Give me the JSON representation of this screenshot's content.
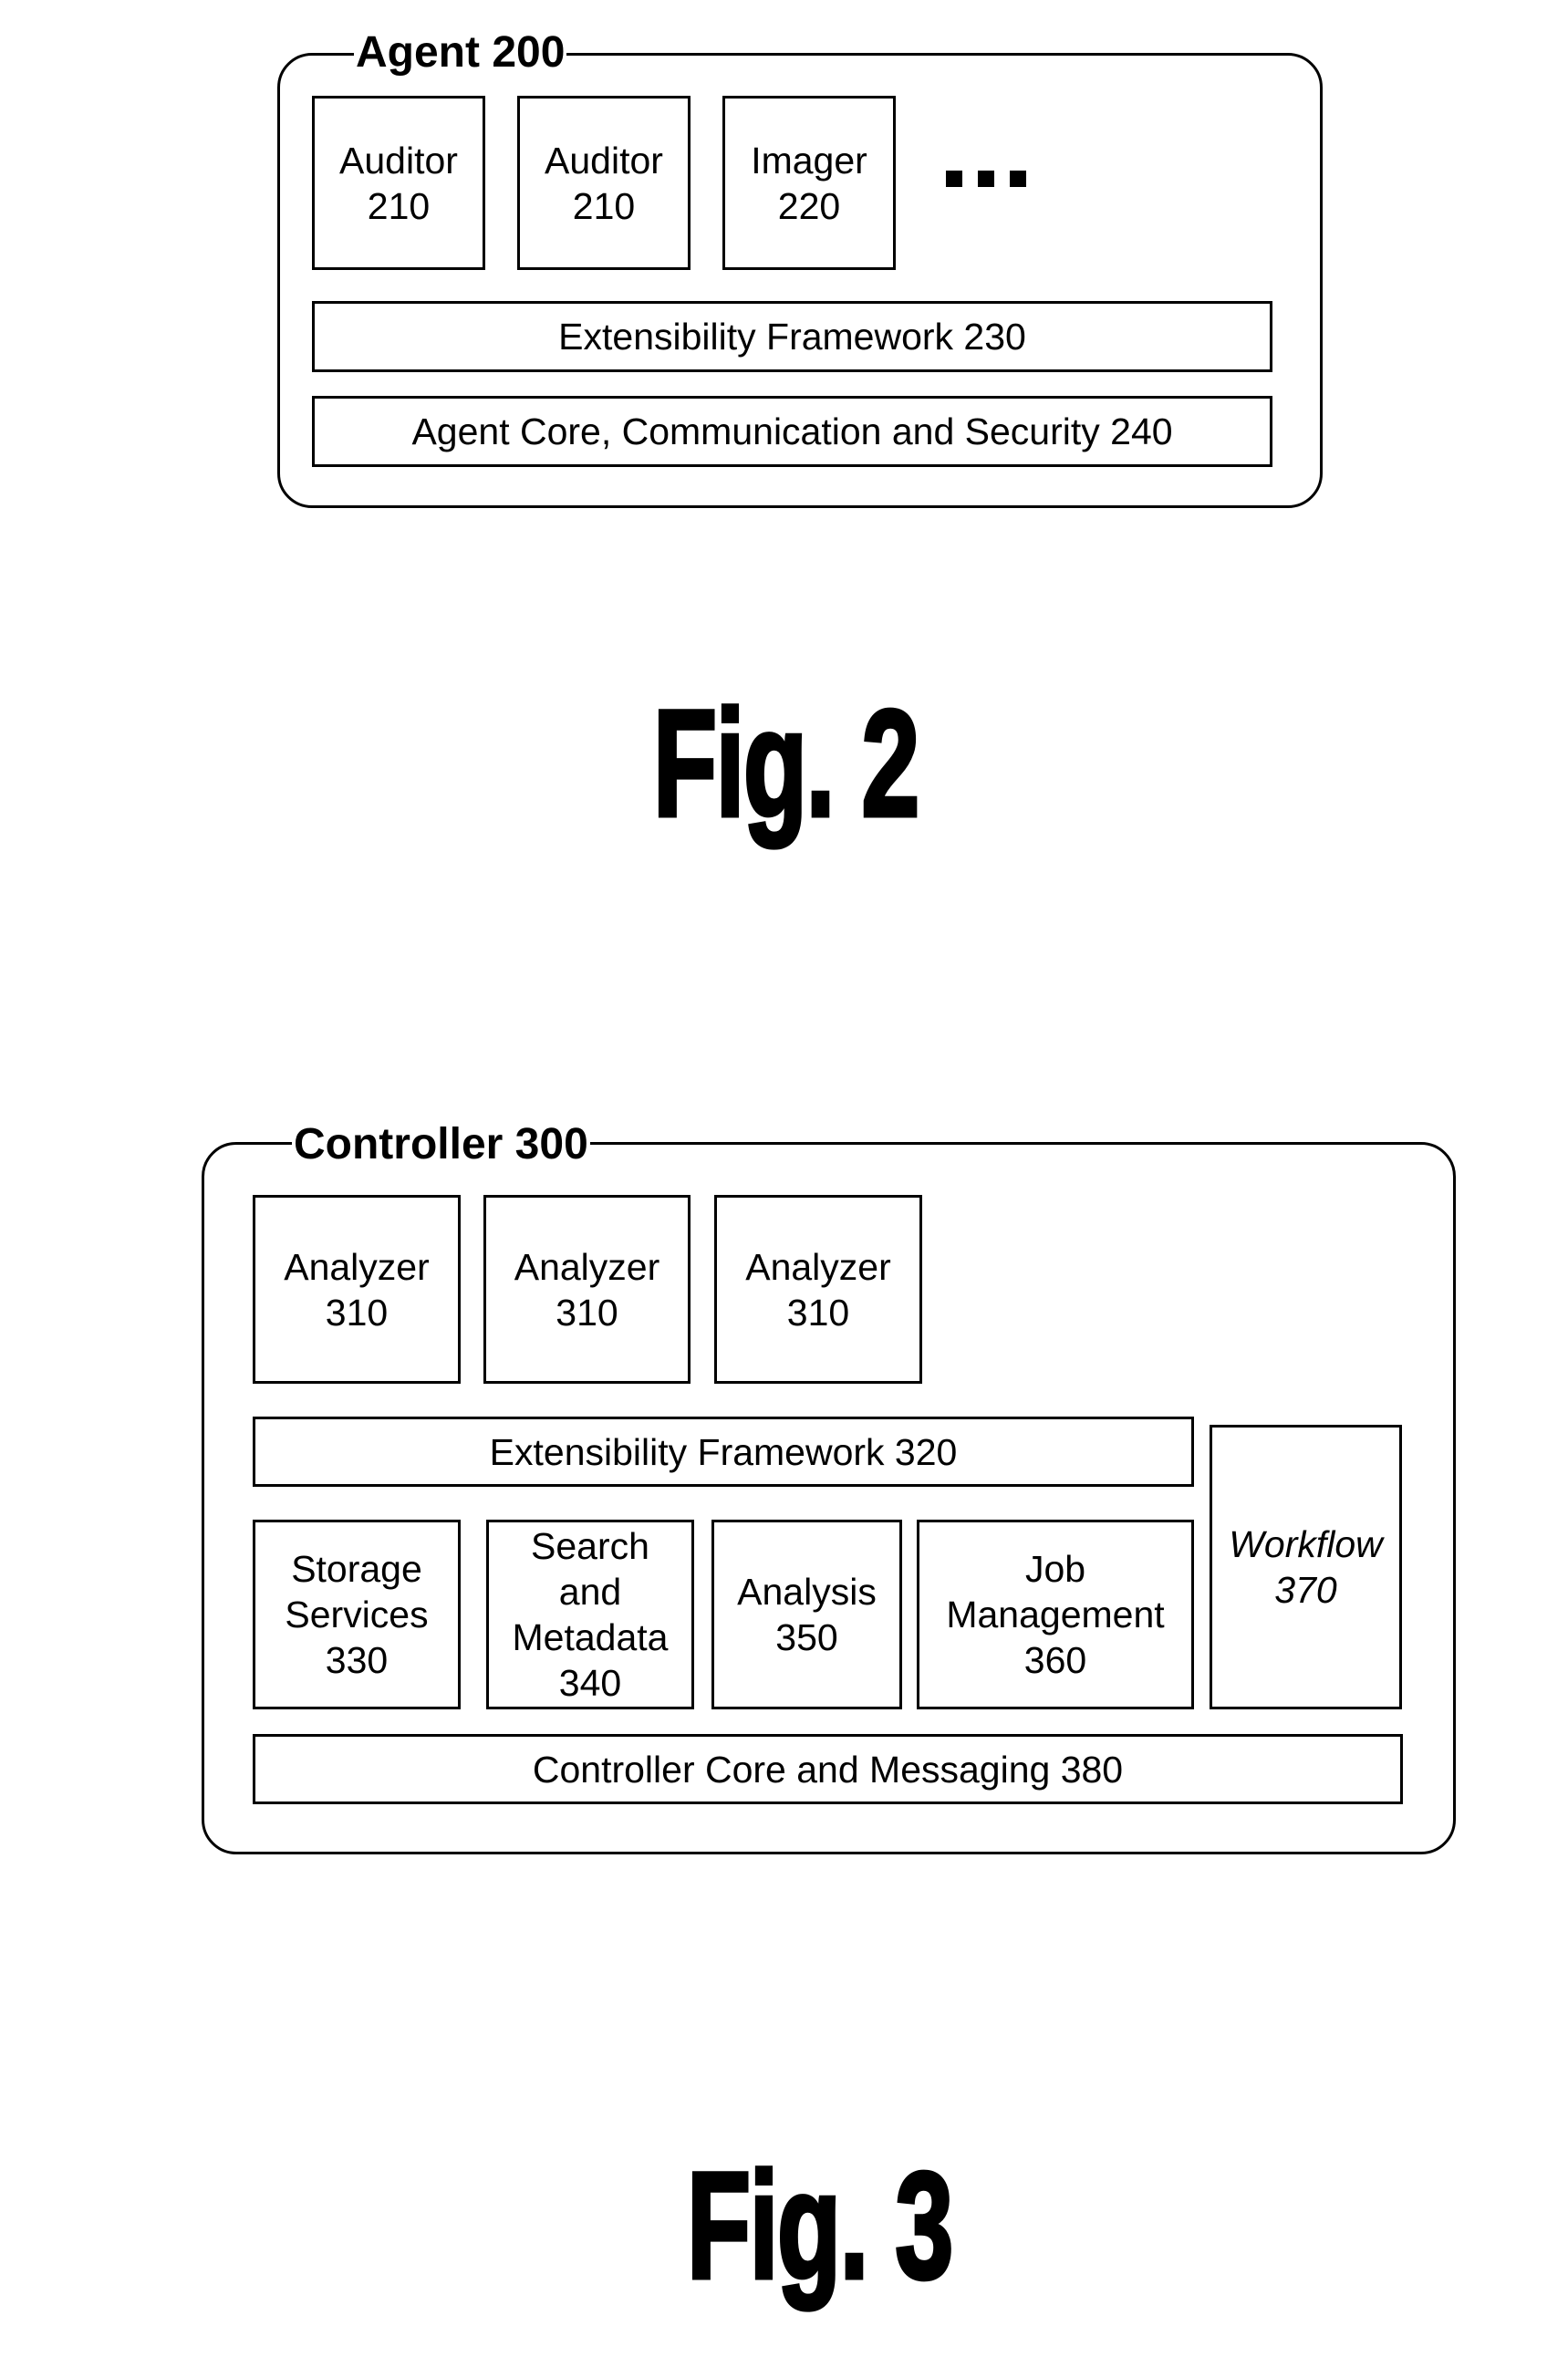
{
  "figure2": {
    "caption": "Fig. 2",
    "container": {
      "title": "Agent 200",
      "modules": [
        {
          "lines": [
            "Auditor",
            "210"
          ]
        },
        {
          "lines": [
            "Auditor",
            "210"
          ]
        },
        {
          "lines": [
            "Imager",
            "220"
          ]
        }
      ],
      "more_indicator": "ellipsis",
      "layers": [
        {
          "label": "Extensibility Framework 230"
        },
        {
          "label": "Agent Core, Communication and Security 240"
        }
      ]
    }
  },
  "figure3": {
    "caption": "Fig. 3",
    "container": {
      "title": "Controller 300",
      "analyzers": [
        {
          "lines": [
            "Analyzer",
            "310"
          ]
        },
        {
          "lines": [
            "Analyzer",
            "310"
          ]
        },
        {
          "lines": [
            "Analyzer",
            "310"
          ]
        }
      ],
      "extensibility": {
        "label": "Extensibility Framework 320"
      },
      "services": [
        {
          "lines": [
            "Storage",
            "Services",
            "330"
          ]
        },
        {
          "lines": [
            "Search",
            "and",
            "Metadata",
            "340"
          ]
        },
        {
          "lines": [
            "Analysis",
            "350"
          ]
        },
        {
          "lines": [
            "Job",
            "Management",
            "360"
          ]
        }
      ],
      "workflow": {
        "lines": [
          "Workflow",
          "370"
        ],
        "style": "italic"
      },
      "core": {
        "label": "Controller Core and Messaging 380"
      }
    }
  }
}
